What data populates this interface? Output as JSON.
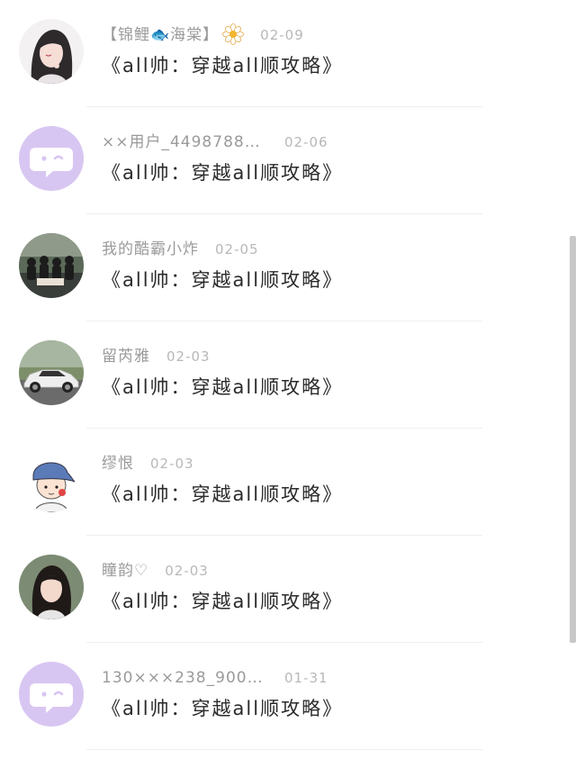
{
  "items": [
    {
      "username": "【锦鲤🐟海棠】",
      "date": "02-09",
      "title": "《all帅：穿越all顺攻略》",
      "avatar": "woman-illustration",
      "badge": "flower-icon"
    },
    {
      "username": "××用户_449878868…",
      "date": "02-06",
      "title": "《all帅：穿越all顺攻略》",
      "avatar": "default-chat-avatar"
    },
    {
      "username": "我的酷霸小炸",
      "date": "02-05",
      "title": "《all帅：穿越all顺攻略》",
      "avatar": "group-photo"
    },
    {
      "username": "留芮雅",
      "date": "02-03",
      "title": "《all帅：穿越all顺攻略》",
      "avatar": "sports-car"
    },
    {
      "username": "缪恨",
      "date": "02-03",
      "title": "《all帅：穿越all顺攻略》",
      "avatar": "cartoon-boy-hat"
    },
    {
      "username": "瞳韵♡",
      "date": "02-03",
      "title": "《all帅：穿越all顺攻略》",
      "avatar": "girl-photo"
    },
    {
      "username": "130×××238_9007728…",
      "date": "01-31",
      "title": "《all帅：穿越all顺攻略》",
      "avatar": "default-chat-avatar"
    }
  ],
  "colors": {
    "default_avatar_bg": "#d8c6f2",
    "title_text": "#2b2b2b",
    "meta_text": "#9a9a9a"
  }
}
